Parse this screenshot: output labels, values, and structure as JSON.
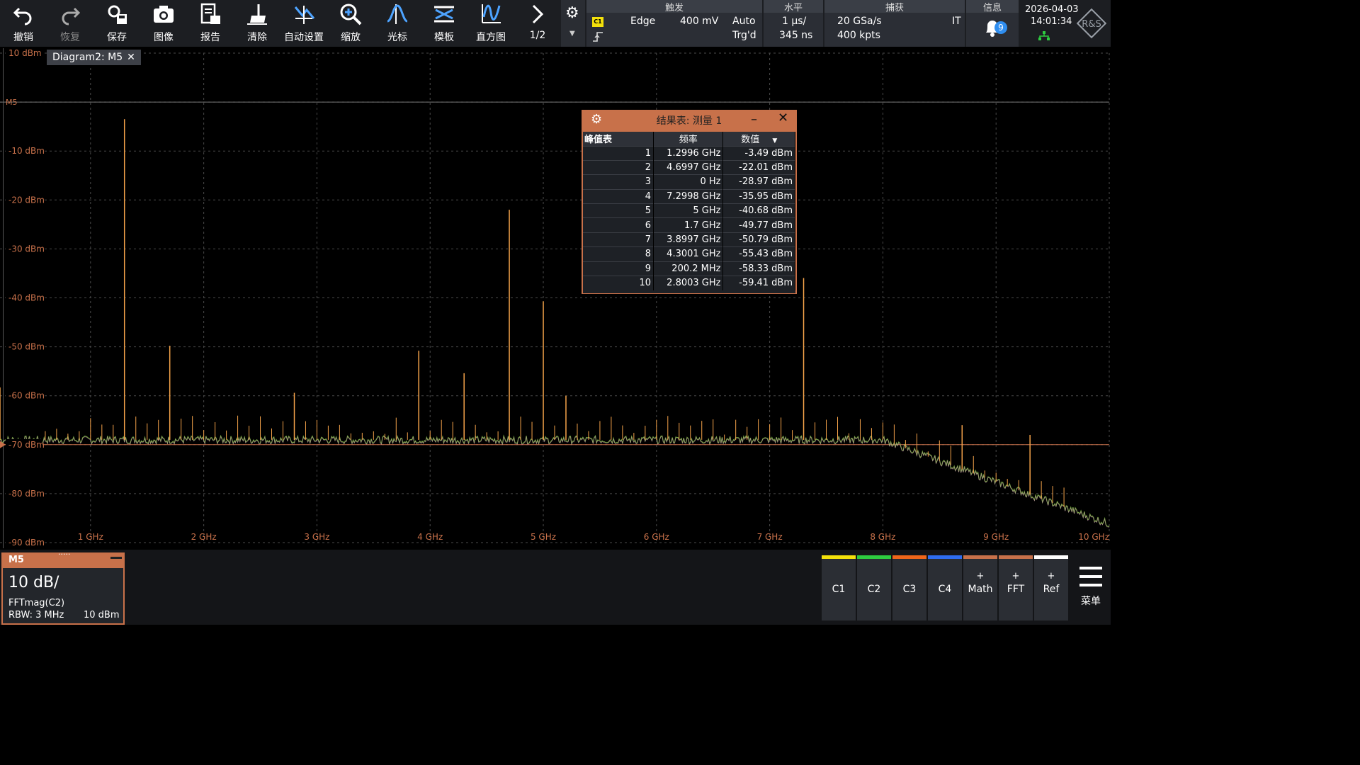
{
  "toolbar": {
    "buttons": [
      {
        "label": "撤销",
        "icon": "undo-icon"
      },
      {
        "label": "恢复",
        "icon": "redo-icon"
      },
      {
        "label": "保存",
        "icon": "save-icon"
      },
      {
        "label": "图像",
        "icon": "camera-icon"
      },
      {
        "label": "报告",
        "icon": "report-icon"
      },
      {
        "label": "清除",
        "icon": "clear-icon"
      },
      {
        "label": "自动设置",
        "icon": "autoset-icon"
      },
      {
        "label": "缩放",
        "icon": "zoom-icon"
      },
      {
        "label": "光标",
        "icon": "cursor-icon"
      },
      {
        "label": "模板",
        "icon": "mask-icon"
      },
      {
        "label": "直方图",
        "icon": "histogram-icon"
      }
    ],
    "page_indicator": "1/2"
  },
  "trigger": {
    "title": "触发",
    "channel": "C1",
    "type": "Edge",
    "level": "400 mV",
    "mode": "Auto",
    "status": "Trg'd"
  },
  "horizontal": {
    "title": "水平",
    "scale": "1 µs/",
    "position": "345 ns"
  },
  "acquisition": {
    "title": "捕获",
    "sample_rate": "20 GSa/s",
    "record_length": "400 kpts",
    "mode": "IT"
  },
  "info": {
    "title": "信息",
    "notification_count": "9"
  },
  "datetime": {
    "date": "2026-04-03",
    "time": "14:01:34"
  },
  "diagram": {
    "tab_label": "Diagram2: M5",
    "tab_close": "✕",
    "marker_label": "M5"
  },
  "chart_data": {
    "type": "line",
    "title": "",
    "xlabel": "",
    "ylabel": "",
    "xlim": [
      0.2,
      10
    ],
    "ylim": [
      -90,
      10
    ],
    "x_unit": "GHz",
    "y_unit": "dBm",
    "x_ticks": [
      "1 GHz",
      "2 GHz",
      "3 GHz",
      "4 GHz",
      "5 GHz",
      "6 GHz",
      "7 GHz",
      "8 GHz",
      "9 GHz",
      "10 GHz"
    ],
    "y_ticks": [
      "10 dBm",
      "-10 dBm",
      "-20 dBm",
      "-30 dBm",
      "-40 dBm",
      "-50 dBm",
      "-60 dBm",
      "-70 dBm",
      "-80 dBm",
      "-90 dBm"
    ],
    "grid": true,
    "trace_color": "#f5a34a",
    "noise_floor_dbm": -69,
    "reference_line_dbm": -70,
    "peaks": [
      {
        "x": 0.2,
        "y": -58.3
      },
      {
        "x": 1.2996,
        "y": -3.49
      },
      {
        "x": 1.7,
        "y": -49.8
      },
      {
        "x": 2.8003,
        "y": -59.4
      },
      {
        "x": 3.8997,
        "y": -50.8
      },
      {
        "x": 4.3001,
        "y": -55.4
      },
      {
        "x": 4.6997,
        "y": -22.0
      },
      {
        "x": 5.0,
        "y": -40.7
      },
      {
        "x": 5.2,
        "y": -60.0
      },
      {
        "x": 7.2998,
        "y": -35.95
      },
      {
        "x": 8.7,
        "y": -66.0
      },
      {
        "x": 9.3,
        "y": -68.0
      }
    ]
  },
  "results_table": {
    "title": "结果表: 测量 1",
    "minimize": "–",
    "close": "✕",
    "columns": [
      "峰值表",
      "频率",
      "数值"
    ],
    "rows": [
      {
        "index": "1",
        "frequency": "1.2996 GHz",
        "value": "-3.49 dBm"
      },
      {
        "index": "2",
        "frequency": "4.6997 GHz",
        "value": "-22.01 dBm"
      },
      {
        "index": "3",
        "frequency": "0 Hz",
        "value": "-28.97 dBm"
      },
      {
        "index": "4",
        "frequency": "7.2998 GHz",
        "value": "-35.95 dBm"
      },
      {
        "index": "5",
        "frequency": "5 GHz",
        "value": "-40.68 dBm"
      },
      {
        "index": "6",
        "frequency": "1.7 GHz",
        "value": "-49.77 dBm"
      },
      {
        "index": "7",
        "frequency": "3.8997 GHz",
        "value": "-50.79 dBm"
      },
      {
        "index": "8",
        "frequency": "4.3001 GHz",
        "value": "-55.43 dBm"
      },
      {
        "index": "9",
        "frequency": "200.2 MHz",
        "value": "-58.33 dBm"
      },
      {
        "index": "10",
        "frequency": "2.8003 GHz",
        "value": "-59.41 dBm"
      }
    ]
  },
  "m5_card": {
    "name": "M5",
    "scale": "10 dB/",
    "source": "FFTmag(C2)",
    "rbw": "RBW: 3 MHz",
    "reference": "10 dBm"
  },
  "channels": [
    {
      "label": "C1",
      "plus": "",
      "color": "#f4e10b"
    },
    {
      "label": "C2",
      "plus": "",
      "color": "#2ecc40"
    },
    {
      "label": "C3",
      "plus": "",
      "color": "#f0661a"
    },
    {
      "label": "C4",
      "plus": "",
      "color": "#2f6df0"
    },
    {
      "label": "Math",
      "plus": "+",
      "color": "#c8714a"
    },
    {
      "label": "FFT",
      "plus": "+",
      "color": "#c8714a"
    },
    {
      "label": "Ref",
      "plus": "+",
      "color": "#ffffff"
    }
  ],
  "menu": {
    "label": "菜单"
  }
}
